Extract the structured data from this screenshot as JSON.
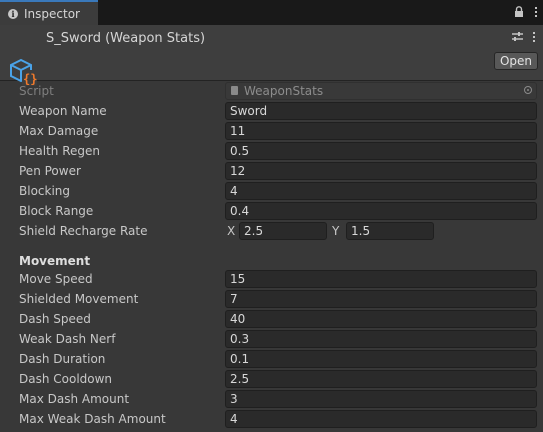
{
  "tab": {
    "label": "Inspector"
  },
  "header": {
    "title": "S_Sword (Weapon Stats)",
    "open_label": "Open"
  },
  "script_row": {
    "label": "Script",
    "value": "WeaponStats"
  },
  "fields": [
    {
      "label": "Weapon Name",
      "value": "Sword"
    },
    {
      "label": "Max Damage",
      "value": "11"
    },
    {
      "label": "Health Regen",
      "value": "0.5"
    },
    {
      "label": "Pen Power",
      "value": "12"
    },
    {
      "label": "Blocking",
      "value": "4"
    },
    {
      "label": "Block Range",
      "value": "0.4"
    }
  ],
  "shield_recharge": {
    "label": "Shield Recharge Rate",
    "x_label": "X",
    "x": "2.5",
    "y_label": "Y",
    "y": "1.5"
  },
  "movement": {
    "heading": "Movement",
    "fields": [
      {
        "label": "Move Speed",
        "value": "15"
      },
      {
        "label": "Shielded Movement",
        "value": "7"
      },
      {
        "label": "Dash Speed",
        "value": "40"
      },
      {
        "label": "Weak Dash Nerf",
        "value": "0.3"
      },
      {
        "label": "Dash Duration",
        "value": "0.1"
      },
      {
        "label": "Dash Cooldown",
        "value": "2.5"
      },
      {
        "label": "Max Dash Amount",
        "value": "3"
      },
      {
        "label": "Max Weak Dash Amount",
        "value": "4"
      }
    ]
  },
  "colors": {
    "accent": "#3a79bb",
    "icon_blue": "#4aa3e8",
    "icon_orange": "#f07a2c"
  }
}
